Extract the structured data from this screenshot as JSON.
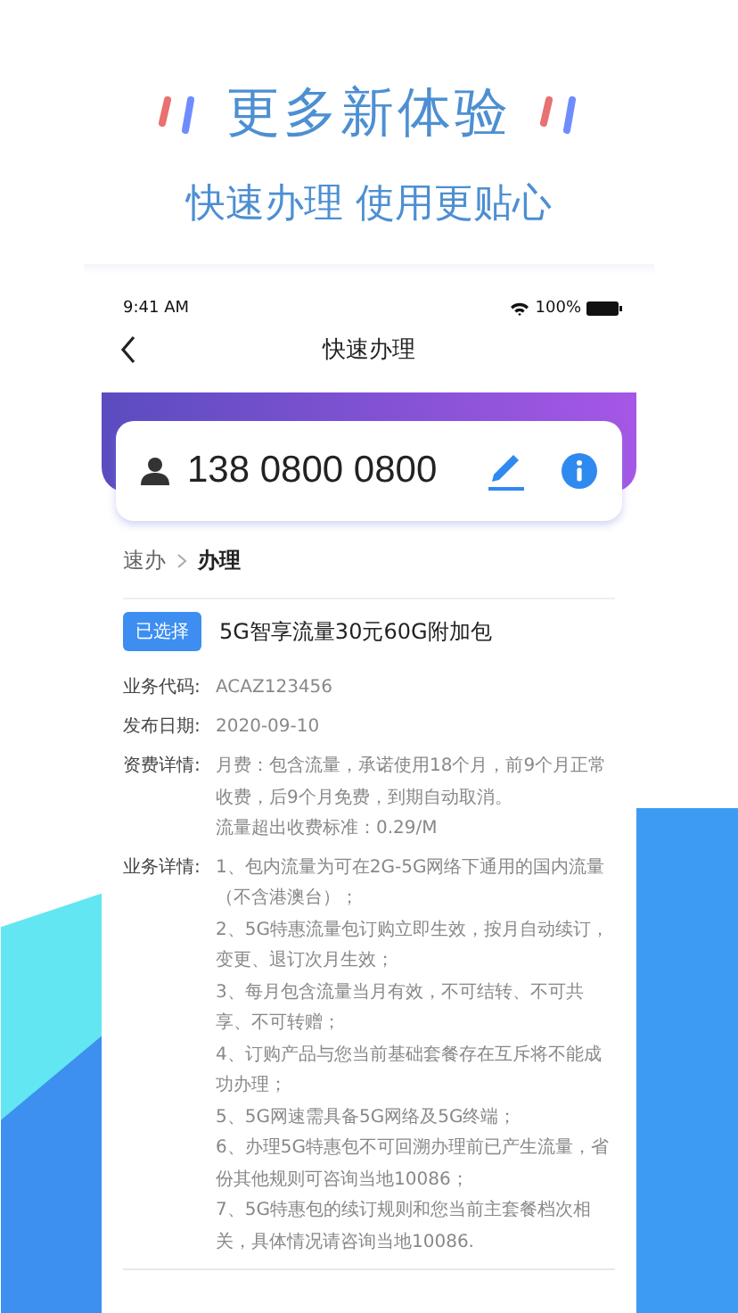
{
  "headline": "更多新体验",
  "subtitle": "快速办理 使用更贴心",
  "phone": {
    "status_bar": {
      "time": "9:41 AM",
      "battery": "100%"
    },
    "nav": {
      "title": "快速办理"
    },
    "account": {
      "number": "138 0800 0800"
    },
    "breadcrumb": [
      {
        "label": "速办",
        "current": false
      },
      {
        "label": "办理",
        "current": true
      }
    ],
    "package": {
      "tag": "已选择",
      "name": "5G智享流量30元60G附加包"
    },
    "fields": [
      {
        "label": "业务代码:",
        "lines": [
          "ACAZ123456"
        ]
      },
      {
        "label": "发布日期:",
        "lines": [
          "2020-09-10"
        ]
      },
      {
        "label": "资费详情:",
        "lines": [
          "月费：包含流量，承诺使用18个月，前9个月正常收费，后9个月免费，到期自动取消。",
          "流量超出收费标准：0.29/M"
        ]
      },
      {
        "label": "业务详情:",
        "lines": [
          "1、包内流量为可在2G-5G网络下通用的国内流量（不含港澳台）；",
          "2、5G特惠流量包订购立即生效，按月自动续订，变更、退订次月生效；",
          "3、每月包含流量当月有效，不可结转、不可共享、不可转赠；",
          "4、订购产品与您当前基础套餐存在互斥将不能成功办理；",
          "5、5G网速需具备5G网络及5G终端；",
          "6、办理5G特惠包不可回溯办理前已产生流量，省份其他规则可咨询当地10086；",
          "7、5G特惠包的续订规则和您当前主套餐档次相关，具体情况请咨询当地10086."
        ]
      }
    ]
  }
}
